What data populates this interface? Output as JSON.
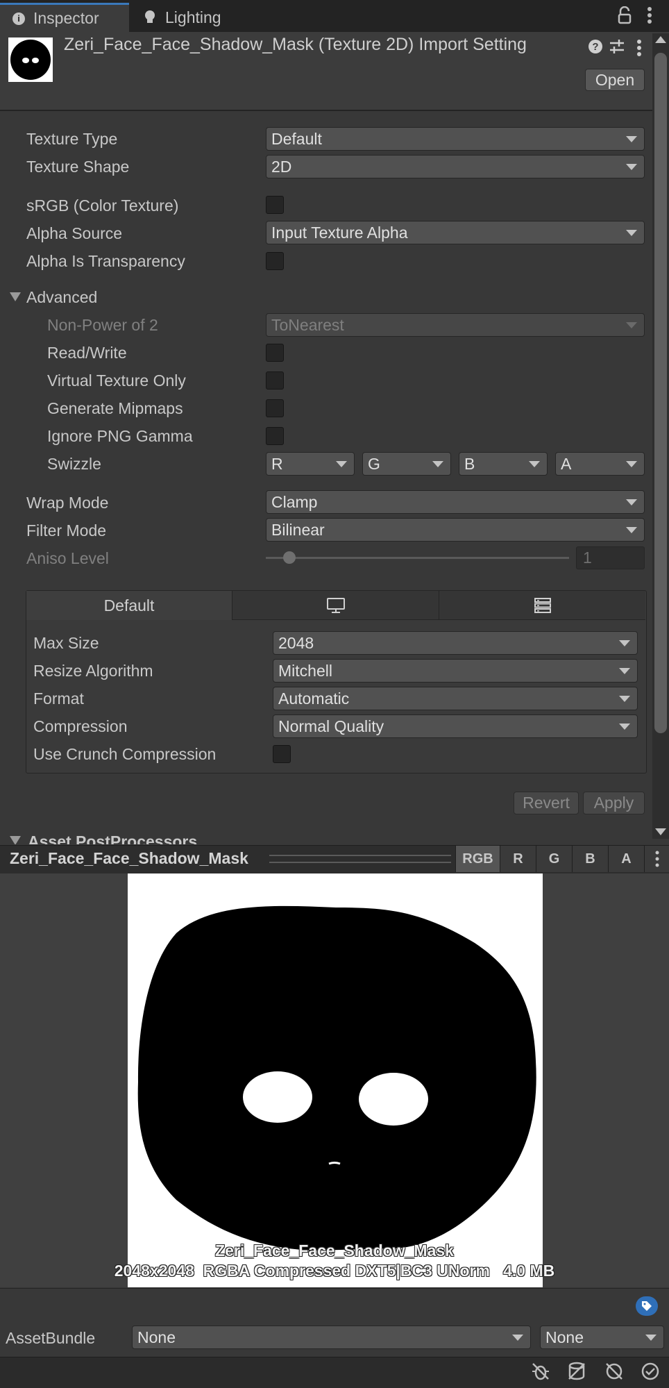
{
  "tabs": [
    {
      "label": "Inspector",
      "icon": "info-icon"
    },
    {
      "label": "Lighting",
      "icon": "lightbulb-icon"
    }
  ],
  "header": {
    "title": "Zeri_Face_Face_Shadow_Mask (Texture 2D) Import Setting",
    "open_label": "Open"
  },
  "props": {
    "texture_type": {
      "label": "Texture Type",
      "value": "Default"
    },
    "texture_shape": {
      "label": "Texture Shape",
      "value": "2D"
    },
    "srgb": {
      "label": "sRGB (Color Texture)",
      "checked": false
    },
    "alpha_source": {
      "label": "Alpha Source",
      "value": "Input Texture Alpha"
    },
    "alpha_transparency": {
      "label": "Alpha Is Transparency",
      "checked": false
    },
    "advanced": {
      "label": "Advanced",
      "expanded": true
    },
    "npot": {
      "label": "Non-Power of 2",
      "value": "ToNearest"
    },
    "read_write": {
      "label": "Read/Write",
      "checked": false
    },
    "virtual_texture": {
      "label": "Virtual Texture Only",
      "checked": false
    },
    "mipmaps": {
      "label": "Generate Mipmaps",
      "checked": false
    },
    "png_gamma": {
      "label": "Ignore PNG Gamma",
      "checked": false
    },
    "swizzle": {
      "label": "Swizzle",
      "values": [
        "R",
        "G",
        "B",
        "A"
      ]
    },
    "wrap_mode": {
      "label": "Wrap Mode",
      "value": "Clamp"
    },
    "filter_mode": {
      "label": "Filter Mode",
      "value": "Bilinear"
    },
    "aniso": {
      "label": "Aniso Level",
      "value": "1",
      "slider_fraction": 0.0
    }
  },
  "platform": {
    "tabs": [
      "Default",
      "monitor-icon",
      "server-icon"
    ],
    "max_size": {
      "label": "Max Size",
      "value": "2048"
    },
    "resize": {
      "label": "Resize Algorithm",
      "value": "Mitchell"
    },
    "format": {
      "label": "Format",
      "value": "Automatic"
    },
    "compression": {
      "label": "Compression",
      "value": "Normal Quality"
    },
    "crunch": {
      "label": "Use Crunch Compression",
      "checked": false
    }
  },
  "actions": {
    "revert": "Revert",
    "apply": "Apply"
  },
  "cut_section": "Asset PostProcessors",
  "preview": {
    "name": "Zeri_Face_Face_Shadow_Mask",
    "channels": [
      "RGB",
      "R",
      "G",
      "B",
      "A"
    ],
    "active_channel": "RGB",
    "info_name": "Zeri_Face_Face_Shadow_Mask",
    "info_details": "2048x2048  RGBA Compressed DXT5|BC3 UNorm   4.0 MB"
  },
  "asset_bundle": {
    "label": "AssetBundle",
    "value": "None",
    "variant": "None"
  },
  "colors": {
    "accent": "#3a79bb",
    "background": "#383838",
    "tag_badge": "#2f6fb8"
  }
}
